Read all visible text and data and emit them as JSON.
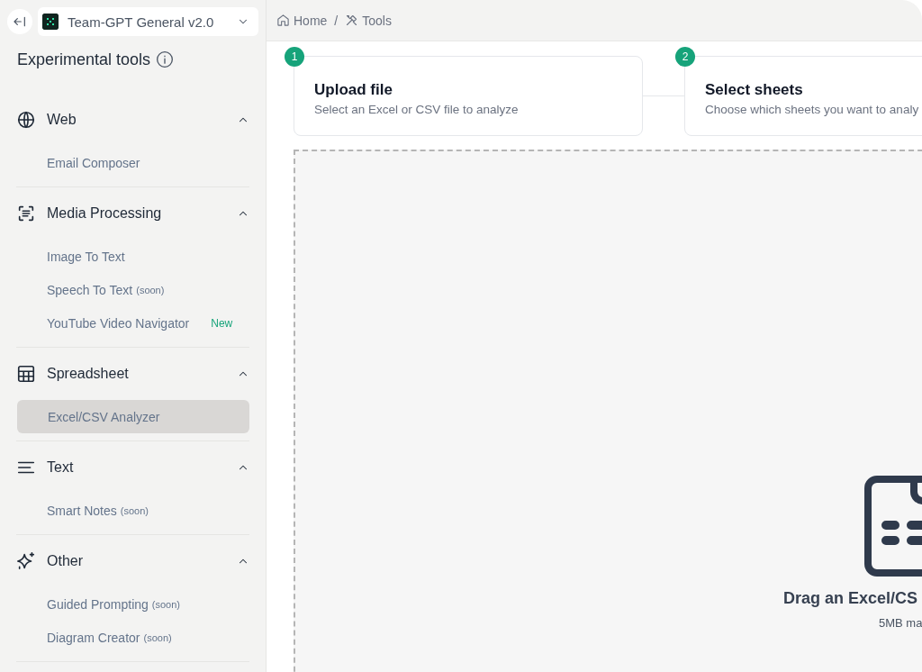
{
  "workspace": {
    "name": "Team-GPT General v2.0"
  },
  "sidebar": {
    "title": "Experimental tools",
    "sections": [
      {
        "title": "Web",
        "expanded": true,
        "items": [
          {
            "label": "Email Composer",
            "selected": false
          }
        ]
      },
      {
        "title": "Media Processing",
        "expanded": true,
        "items": [
          {
            "label": "Image To Text",
            "selected": false
          },
          {
            "label": "Speech To Text",
            "suffix": "(soon)",
            "selected": false
          },
          {
            "label": "YouTube Video Navigator",
            "badge": "New",
            "selected": false
          }
        ]
      },
      {
        "title": "Spreadsheet",
        "expanded": true,
        "items": [
          {
            "label": "Excel/CSV Analyzer",
            "selected": true
          }
        ]
      },
      {
        "title": "Text",
        "expanded": true,
        "items": [
          {
            "label": "Smart Notes",
            "suffix": "(soon)",
            "selected": false
          }
        ]
      },
      {
        "title": "Other",
        "expanded": true,
        "items": [
          {
            "label": "Guided Prompting",
            "suffix": "(soon)",
            "selected": false
          },
          {
            "label": "Diagram Creator",
            "suffix": "(soon)",
            "selected": false
          }
        ]
      }
    ]
  },
  "breadcrumb": [
    "Home",
    "Tools"
  ],
  "breadcrumb_separator": "/",
  "steps": [
    {
      "number": "1",
      "title": "Upload file",
      "description": "Select an Excel or CSV file to analyze"
    },
    {
      "number": "2",
      "title": "Select sheets",
      "description": "Choose which sheets you want to analy"
    }
  ],
  "dropzone": {
    "title": "Drag an Excel/CS",
    "hint": "5MB ma"
  }
}
